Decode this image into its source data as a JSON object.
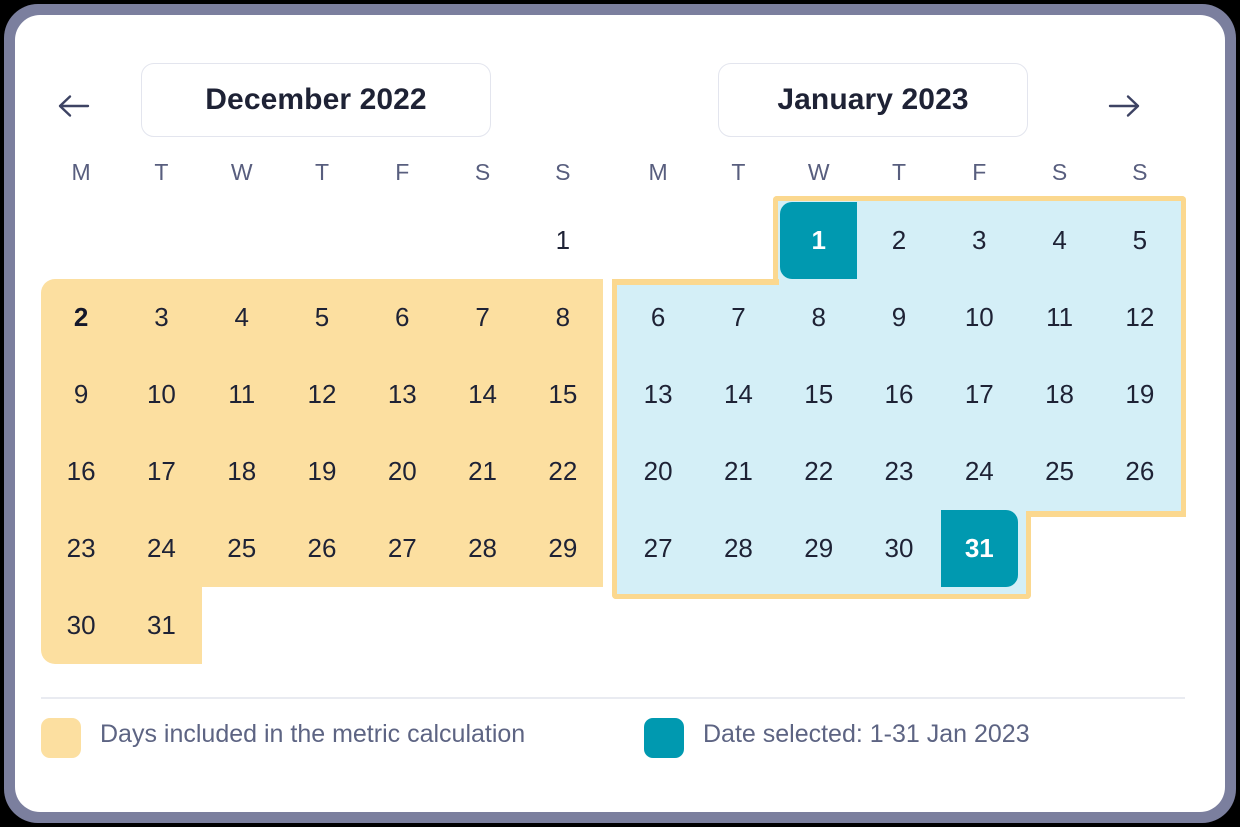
{
  "nav": {
    "prev_label": "Previous months",
    "next_label": "Next months",
    "prev_icon": "arrow-left-icon",
    "next_icon": "arrow-right-icon"
  },
  "colors": {
    "frame": "#7b7f9e",
    "card": "#ffffff",
    "metric_yellow": "#fcdfa0",
    "metric_yellow_border": "#fbd88f",
    "selected_range_blue": "#d4eff7",
    "selected_teal": "#0099b0",
    "text_dark": "#1e2235",
    "text_muted": "#5d6483",
    "pill_border": "#e3e5ee",
    "divider": "#e9ebf1"
  },
  "calendars": [
    {
      "id": "december-2022",
      "title": "December 2022",
      "weekdays": [
        "M",
        "T",
        "W",
        "T",
        "F",
        "S",
        "S"
      ],
      "lead_blanks": 3,
      "days": [
        1,
        2,
        3,
        4,
        5,
        6,
        7,
        8,
        9,
        10,
        11,
        12,
        13,
        14,
        15,
        16,
        17,
        18,
        19,
        20,
        21,
        22,
        23,
        24,
        25,
        26,
        27,
        28,
        29,
        30,
        31
      ],
      "metric_days": [
        2,
        3,
        4,
        5,
        6,
        7,
        8,
        9,
        10,
        11,
        12,
        13,
        14,
        15,
        16,
        17,
        18,
        19,
        20,
        21,
        22,
        23,
        24,
        25,
        26,
        27,
        28,
        29,
        30,
        31
      ],
      "range_days": [],
      "selected_days": [],
      "emphasized_days": [
        2
      ]
    },
    {
      "id": "january-2023",
      "title": "January 2023",
      "weekdays": [
        "M",
        "T",
        "W",
        "T",
        "F",
        "S",
        "S"
      ],
      "lead_blanks": 2,
      "days": [
        1,
        2,
        3,
        4,
        5,
        6,
        7,
        8,
        9,
        10,
        11,
        12,
        13,
        14,
        15,
        16,
        17,
        18,
        19,
        20,
        21,
        22,
        23,
        24,
        25,
        26,
        27,
        28,
        29,
        30,
        31
      ],
      "metric_days": [],
      "range_days": [
        1,
        2,
        3,
        4,
        5,
        6,
        7,
        8,
        9,
        10,
        11,
        12,
        13,
        14,
        15,
        16,
        17,
        18,
        19,
        20,
        21,
        22,
        23,
        24,
        25,
        26,
        27,
        28,
        29,
        30,
        31
      ],
      "selected_days": [
        1,
        31
      ],
      "emphasized_days": []
    }
  ],
  "legend": {
    "items": [
      {
        "swatch_color": "#fcdfa0",
        "label": "Days included in the metric calculation"
      },
      {
        "swatch_color": "#0099b0",
        "label": "Date selected: 1-31 Jan 2023"
      }
    ]
  }
}
